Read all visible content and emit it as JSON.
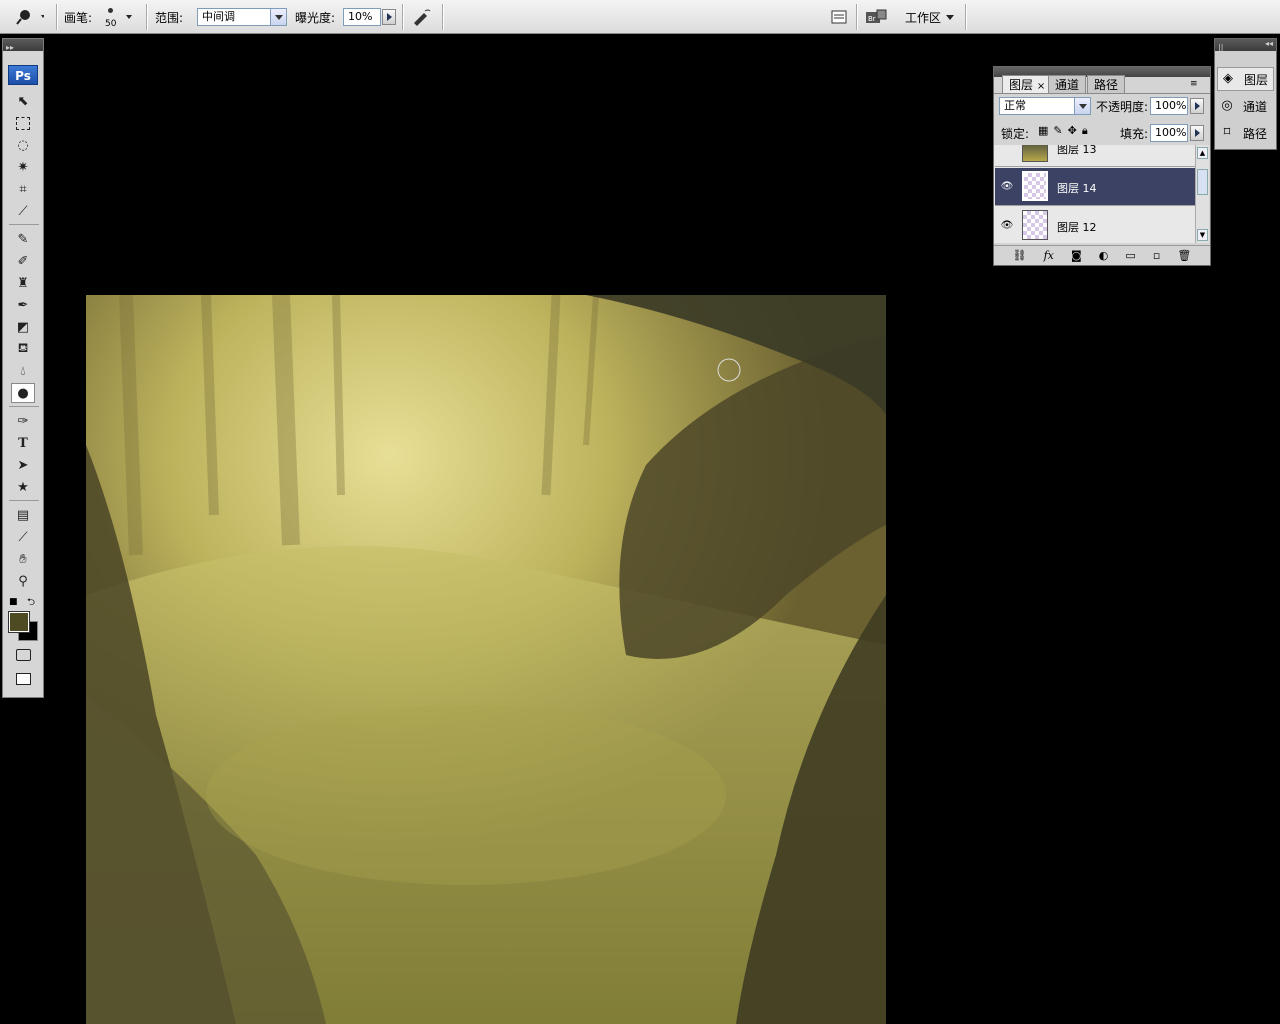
{
  "options_bar": {
    "brush_label": "画笔:",
    "brush_size": "50",
    "range_label": "范围:",
    "range_value": "中间调",
    "exposure_label": "曝光度:",
    "exposure_value": "10%",
    "workspace_label": "工作区"
  },
  "toolbox": {
    "logo": "Ps"
  },
  "layers_panel": {
    "tabs": [
      "图层",
      "通道",
      "路径"
    ],
    "blend_mode": "正常",
    "opacity_label": "不透明度:",
    "opacity_value": "100%",
    "lock_label": "锁定:",
    "fill_label": "填充:",
    "fill_value": "100%",
    "layers": [
      {
        "name": "图层 13",
        "visible": false,
        "selected": false
      },
      {
        "name": "图层 14",
        "visible": true,
        "selected": true
      },
      {
        "name": "图层 12",
        "visible": true,
        "selected": false
      }
    ]
  },
  "dock": {
    "items": [
      "图层",
      "通道",
      "路径"
    ]
  },
  "colors": {
    "foreground": "#4e4a22",
    "background": "#000000",
    "selection": "#3b4263"
  }
}
